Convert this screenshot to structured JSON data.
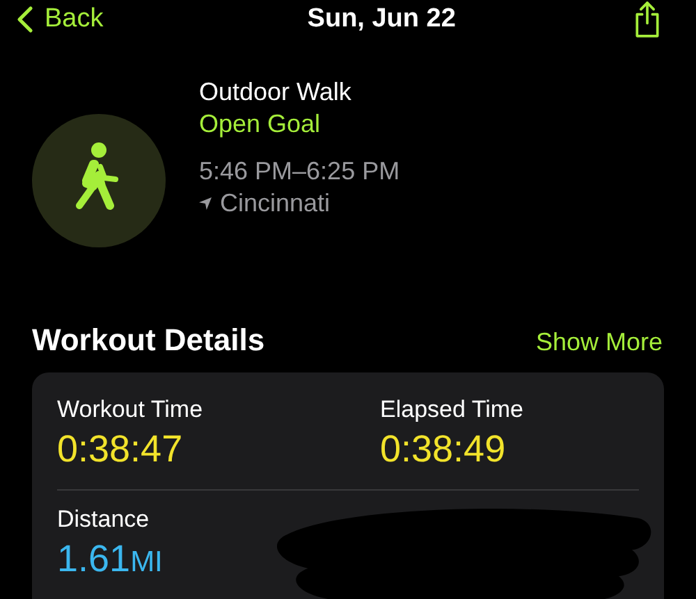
{
  "nav": {
    "back": "Back",
    "title": "Sun, Jun 22"
  },
  "workout": {
    "name": "Outdoor Walk",
    "goal": "Open Goal",
    "time": "5:46 PM–6:25 PM",
    "location": "Cincinnati"
  },
  "details": {
    "title": "Workout Details",
    "action": "Show More",
    "metrics": [
      {
        "label": "Workout Time",
        "value": "0:38:47",
        "color": "#f2e32b"
      },
      {
        "label": "Elapsed Time",
        "value": "0:38:49",
        "color": "#f2e32b"
      },
      {
        "label": "Distance",
        "value": "1.61",
        "unit": "MI",
        "color": "#3bb7ef"
      }
    ]
  }
}
